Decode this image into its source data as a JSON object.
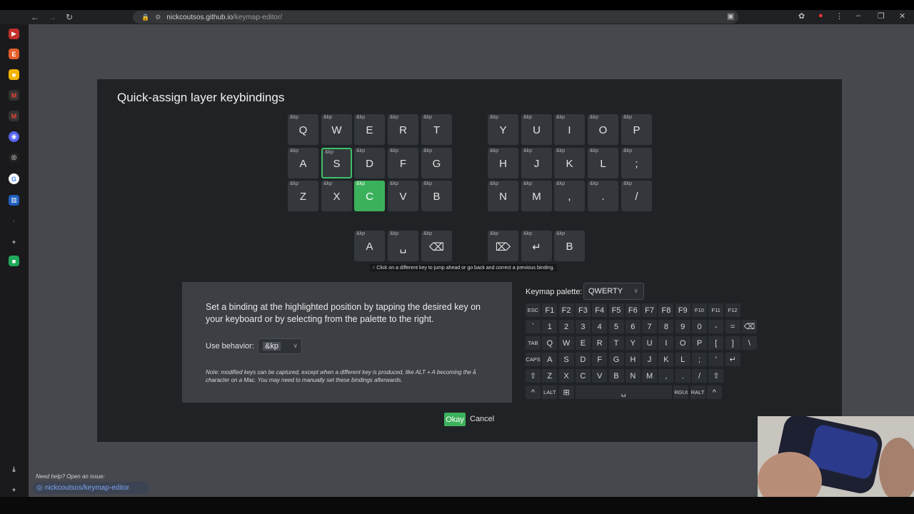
{
  "browser": {
    "url_host": "nickcoutsos.github.io",
    "url_path": "/keymap-editor/",
    "back_icon": "arrow-left-icon",
    "reload_icon": "reload-icon"
  },
  "modal": {
    "title": "Quick-assign layer keybindings",
    "behavior_prefix": "&kp",
    "keys": [
      {
        "label": "Q"
      },
      {
        "label": "W"
      },
      {
        "label": "E"
      },
      {
        "label": "R"
      },
      {
        "label": "T"
      },
      {
        "label": "Y"
      },
      {
        "label": "U"
      },
      {
        "label": "I"
      },
      {
        "label": "O"
      },
      {
        "label": "P"
      },
      {
        "label": "A"
      },
      {
        "label": "S"
      },
      {
        "label": "D"
      },
      {
        "label": "F"
      },
      {
        "label": "G"
      },
      {
        "label": "H"
      },
      {
        "label": "J"
      },
      {
        "label": "K"
      },
      {
        "label": "L"
      },
      {
        "label": ";"
      },
      {
        "label": "Z"
      },
      {
        "label": "X"
      },
      {
        "label": "C"
      },
      {
        "label": "V"
      },
      {
        "label": "B"
      },
      {
        "label": "N"
      },
      {
        "label": "M"
      },
      {
        "label": ","
      },
      {
        "label": "."
      },
      {
        "label": "/"
      },
      {
        "label": "A"
      },
      {
        "label": "␣"
      },
      {
        "label": "⌫"
      },
      {
        "label": "⌦"
      },
      {
        "label": "↵"
      },
      {
        "label": "B"
      }
    ],
    "hint": "☝ Click on a different key to jump ahead or go back and correct a previous binding.",
    "instructions": "Set a binding at the highlighted position by tapping the desired key on your keyboard or by selecting from the palette to the right.",
    "use_behavior_label": "Use behavior:",
    "use_behavior_value": "&kp",
    "note": "Note: modified keys can be captured, except when a different key is produced, like ALT + A becoming the å character on a Mac. You may need to manually set these bindings afterwards.",
    "palette_label": "Keymap palette:",
    "palette_value": "QWERTY",
    "palette_rows": [
      [
        "ESC",
        "F1",
        "F2",
        "F3",
        "F4",
        "F5",
        "F6",
        "F7",
        "F8",
        "F9",
        "F10",
        "F11",
        "F12"
      ],
      [
        "`",
        "1",
        "2",
        "3",
        "4",
        "5",
        "6",
        "7",
        "8",
        "9",
        "0",
        "-",
        "=",
        "⌫"
      ],
      [
        "TAB",
        "Q",
        "W",
        "E",
        "R",
        "T",
        "Y",
        "U",
        "I",
        "O",
        "P",
        "[",
        "]",
        "\\"
      ],
      [
        "CAPS",
        "A",
        "S",
        "D",
        "F",
        "G",
        "H",
        "J",
        "K",
        "L",
        ";",
        "'",
        "↵"
      ],
      [
        "⇧",
        "Z",
        "X",
        "C",
        "V",
        "B",
        "N",
        "M",
        ",",
        ".",
        "/",
        "⇧"
      ],
      [
        "^",
        "LALT",
        "⊞",
        "␣",
        "RGUI",
        "RALT",
        "^"
      ]
    ],
    "okay_label": "Okay",
    "cancel_label": "Cancel"
  },
  "sidebar": {
    "help_text": "Need help? Open an issue:",
    "help_link": "nickcoutsos/keymap-editor"
  },
  "colors": {
    "accent": "#3cb15c",
    "modal_bg": "#202326",
    "key_bg": "#34383c"
  }
}
